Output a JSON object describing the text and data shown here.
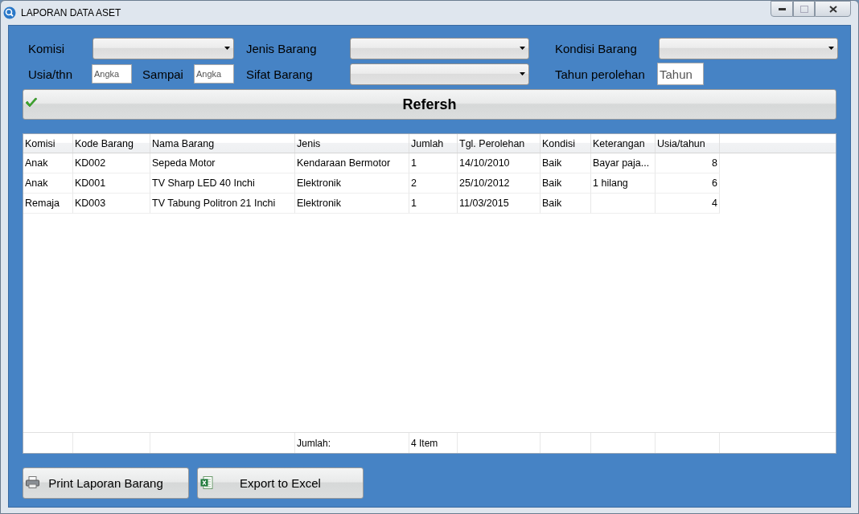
{
  "window": {
    "title": "LAPORAN DATA ASET"
  },
  "filters": [
    {
      "kind": "dropdown",
      "label": "Komisi"
    },
    {
      "kind": "dropdown",
      "label": "Jenis Barang"
    },
    {
      "kind": "dropdown",
      "label": "Kondisi Barang"
    },
    {
      "kind": "range",
      "label": "Usia/thn",
      "from_placeholder": "Angka",
      "separator": "Sampai",
      "to_placeholder": "Angka"
    },
    {
      "kind": "dropdown",
      "label": "Sifat Barang"
    },
    {
      "kind": "field",
      "label": "Tahun perolehan",
      "placeholder": "Tahun"
    }
  ],
  "refresh_button": {
    "label": "Refersh"
  },
  "table": {
    "columns": [
      {
        "label": "Komisi",
        "kind": "text"
      },
      {
        "label": "Kode Barang",
        "kind": "text"
      },
      {
        "label": "Nama Barang",
        "kind": "text"
      },
      {
        "label": "Jenis",
        "kind": "text"
      },
      {
        "label": "Jumlah",
        "kind": "text"
      },
      {
        "label": "Tgl. Perolehan",
        "kind": "text"
      },
      {
        "label": "Kondisi",
        "kind": "text"
      },
      {
        "label": "Keterangan",
        "kind": "text"
      },
      {
        "label": "Usia/tahun",
        "kind": "number"
      }
    ],
    "rows": [
      [
        "Anak",
        "KD002",
        "Sepeda Motor",
        "Kendaraan Bermotor",
        "1",
        "14/10/2010",
        "Baik",
        "Bayar paja...",
        "8"
      ],
      [
        "Anak",
        "KD001",
        "TV Sharp LED 40 Inchi",
        "Elektronik",
        "2",
        "25/10/2012",
        "Baik",
        "1 hilang",
        "6"
      ],
      [
        "Remaja",
        "KD003",
        "TV Tabung Politron 21 Inchi",
        "Elektronik",
        "1",
        "11/03/2015",
        "Baik",
        null,
        "4"
      ]
    ],
    "footer": {
      "label": "Jumlah:",
      "total": "4 Item"
    }
  },
  "buttons": [
    {
      "kind": "print",
      "label": "Print Laporan Barang"
    },
    {
      "kind": "excel",
      "label": "Export to Excel"
    }
  ]
}
